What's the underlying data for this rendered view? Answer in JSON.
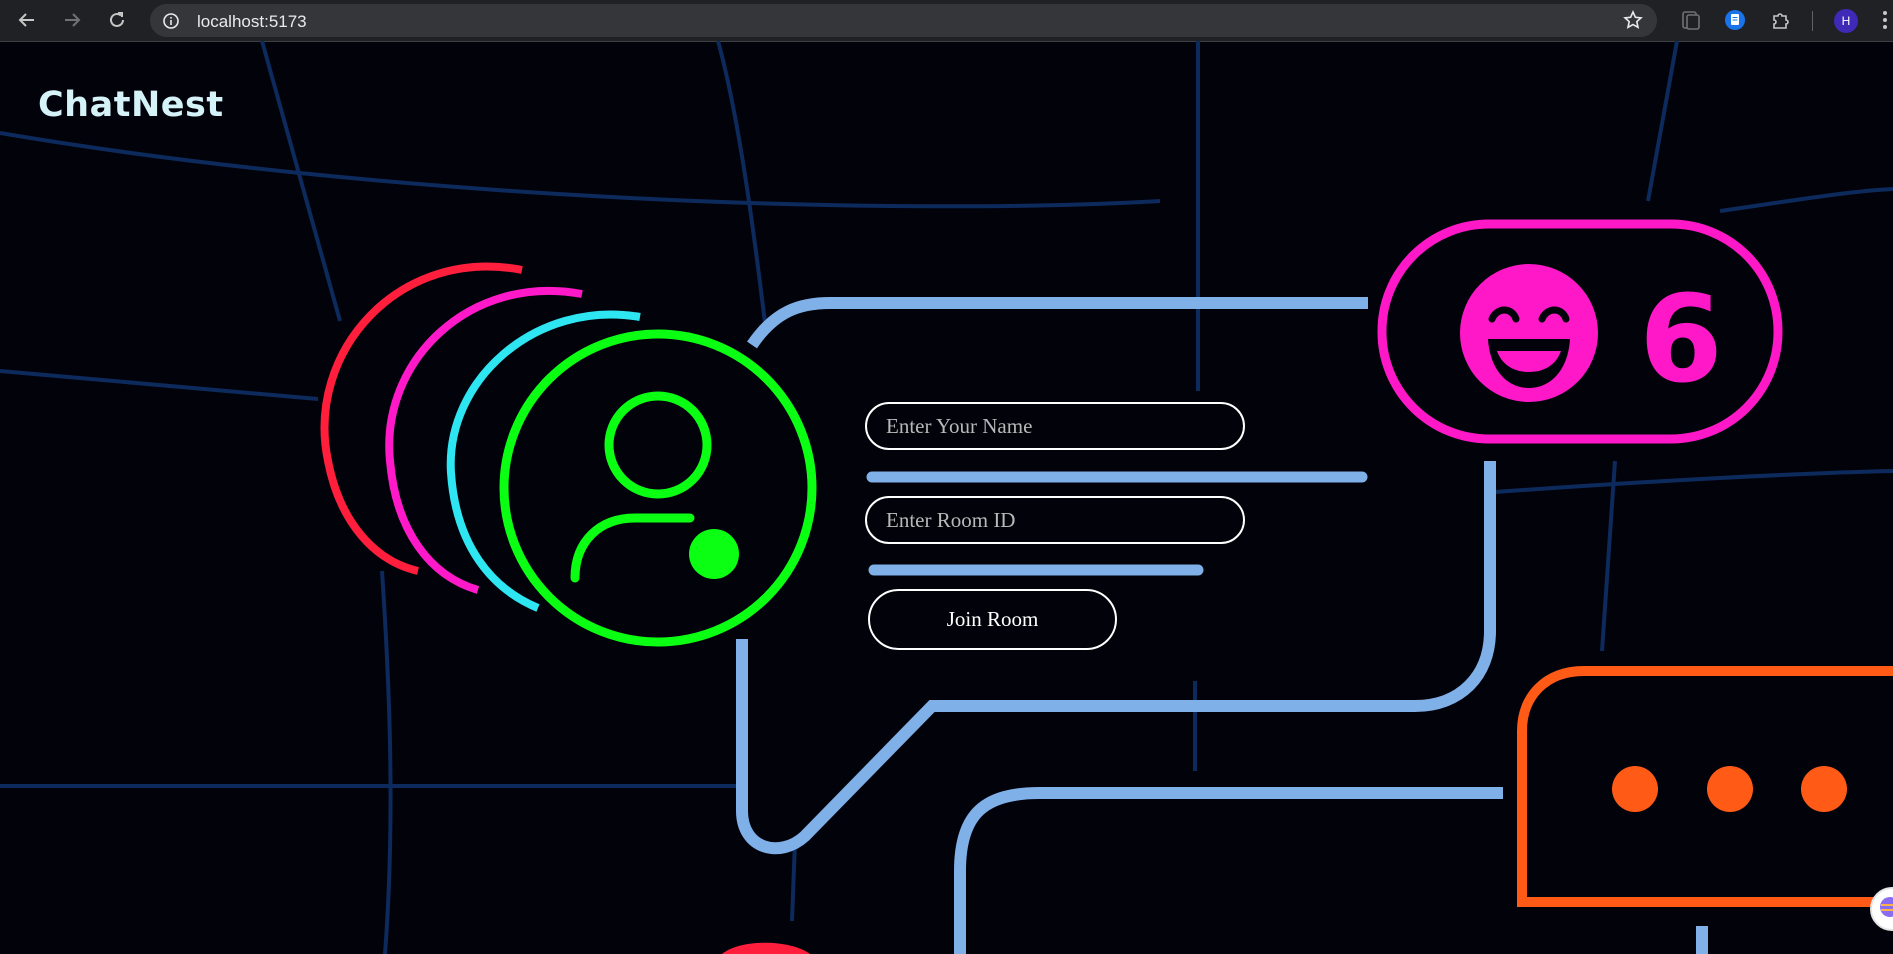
{
  "browser": {
    "url": "localhost:5173",
    "profile_initial": "H"
  },
  "app": {
    "logo": "ChatNest"
  },
  "form": {
    "name_placeholder": "Enter Your Name",
    "room_placeholder": "Enter Room ID",
    "join_label": "Join Room"
  },
  "illustration": {
    "notification_count": "6",
    "colors": {
      "background": "#02020b",
      "grid_lines": "#0d2a5c",
      "bubble_outline": "#7fb0e8",
      "avatar_green": "#0bff12",
      "arc_red": "#ff1f3d",
      "arc_magenta": "#ff19c9",
      "arc_cyan": "#2ee6f2",
      "badge_magenta": "#ff18c8",
      "typing_orange": "#ff5a16"
    }
  }
}
